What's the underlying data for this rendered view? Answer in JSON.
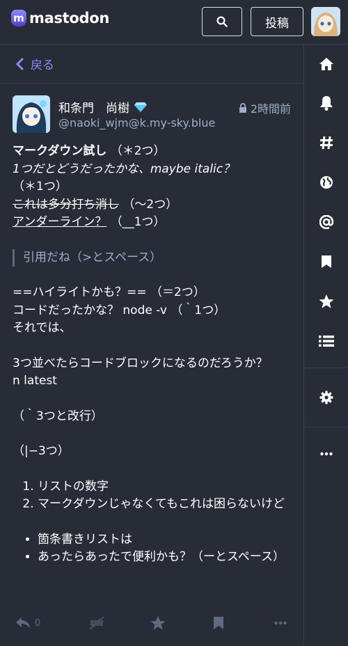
{
  "header": {
    "logo_text": "mastodon",
    "logo_mark": "m",
    "post_label": "投稿"
  },
  "back": {
    "label": "戻る"
  },
  "status": {
    "display_name": "和条門　尚樹",
    "acct": "@naoki_wjm@k.my-sky.blue",
    "time": "2時間前",
    "lines": {
      "l1_bold": "マークダウン試し",
      "l1_rest": "（＊2つ）",
      "l2_italic1": "1つだとどうだったかな、maybe italic？",
      "l2_rest": "（＊1つ）",
      "l3_strike": "これは多分打ち消し",
      "l3_rest": "（〜2つ）",
      "l4_under": "アンダーライン？",
      "l4_rest": "（__1つ）",
      "quote": "引用だね（>とスペース）",
      "l5": "==ハイライトかも？== （＝2つ）",
      "l6": "コードだったかな？ node -v （｀1つ）",
      "l7": "それでは、",
      "l8": "3つ並べたらコードブロックになるのだろうか？",
      "l9": "n latest",
      "l10": "（｀3つと改行）",
      "l11": "（|−3つ）",
      "ol": [
        "リストの数字",
        "マークダウンじゃなくてもこれは困らないけど"
      ],
      "ul": [
        "箇条書きリストは",
        "あったらあったで便利かも？（ーとスペース）"
      ]
    },
    "reply_count": "0"
  },
  "colors": {
    "background": "#282c37",
    "accent": "#8c8dff",
    "muted": "#9baec8",
    "border": "#393f4f"
  },
  "icons": {
    "search": "search-icon",
    "back": "chevron-left-icon",
    "nav": [
      "home-icon",
      "bell-icon",
      "hashtag-icon",
      "globe-icon",
      "at-icon",
      "bookmark-icon",
      "star-icon",
      "list-icon",
      "gear-icon",
      "ellipsis-icon"
    ]
  }
}
